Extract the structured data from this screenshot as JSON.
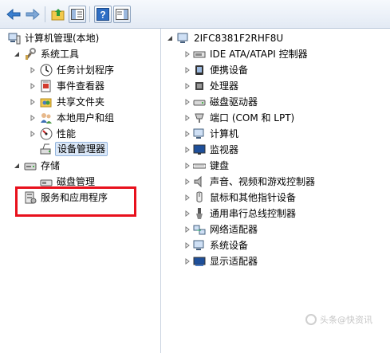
{
  "left_tree": {
    "root": "计算机管理(本地)",
    "system_tools": "系统工具",
    "system_tools_children": [
      "任务计划程序",
      "事件查看器",
      "共享文件夹",
      "本地用户和组",
      "性能",
      "设备管理器"
    ],
    "storage": "存储",
    "storage_children": [
      "磁盘管理"
    ],
    "services": "服务和应用程序"
  },
  "right_tree": {
    "computer_name": "2IFC8381F2RHF8U",
    "categories": [
      "IDE ATA/ATAPI 控制器",
      "便携设备",
      "处理器",
      "磁盘驱动器",
      "端口 (COM 和 LPT)",
      "计算机",
      "监视器",
      "键盘",
      "声音、视频和游戏控制器",
      "鼠标和其他指针设备",
      "通用串行总线控制器",
      "网络适配器",
      "系统设备",
      "显示适配器"
    ]
  },
  "watermark": "头条@快资讯",
  "colors": {
    "highlight_border": "#e8101c",
    "selection_bg": "#dbe8f8",
    "toolbar_bg": "#e3eaf4"
  }
}
